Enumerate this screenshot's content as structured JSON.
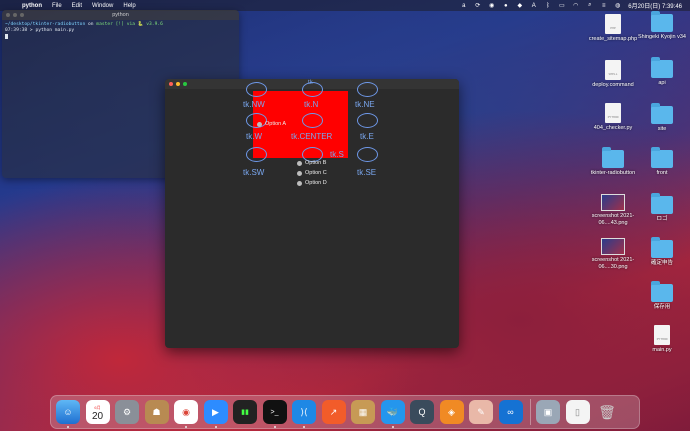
{
  "menubar": {
    "app_name": "python",
    "items": [
      "File",
      "Edit",
      "Window",
      "Help"
    ],
    "clock": "6月20日(日) 7:39:46"
  },
  "terminal": {
    "title": "python",
    "line1_path": "~/desktop/tkinter-radiobutton",
    "line1_rest": " on ",
    "line1_branch": "master [!] via 🐍 v3.9.6",
    "line2_time": "07:39:38",
    "line2_cmd": " > python main.py"
  },
  "tk": {
    "top_label": "tk",
    "anchors": [
      "tk.NW",
      "tk.N",
      "tk.NE",
      "tk.W",
      "tk.CENTER",
      "tk.E",
      "tk.SW",
      "tk.S",
      "tk.SE"
    ],
    "radio_options": [
      "Option A",
      "Option B",
      "Option C",
      "Option D"
    ]
  },
  "desktop": {
    "items": [
      {
        "label": "create_sitemap.php",
        "icon": "php-file-icon"
      },
      {
        "label": "Shingeki Kyojin v34",
        "icon": "folder-icon"
      },
      {
        "label": "deploy.command",
        "icon": "shell-file-icon"
      },
      {
        "label": "api",
        "icon": "folder-icon"
      },
      {
        "label": "404_checker.py",
        "icon": "python-file-icon"
      },
      {
        "label": "site",
        "icon": "folder-icon"
      },
      {
        "label": "tkinter-radiobutton",
        "icon": "folder-icon"
      },
      {
        "label": "front",
        "icon": "folder-icon"
      },
      {
        "label": "screenshot 2021-06....43.png",
        "icon": "image-file-icon"
      },
      {
        "label": "ロゴ",
        "icon": "folder-icon"
      },
      {
        "label": "screenshot 2021-06....30.png",
        "icon": "image-file-icon"
      },
      {
        "label": "確定申告",
        "icon": "folder-icon"
      },
      {
        "label": "保存用",
        "icon": "folder-icon"
      },
      {
        "label": "main.py",
        "icon": "python-file-icon"
      }
    ]
  },
  "dock": {
    "calendar_day": "20",
    "calendar_month": "6月"
  }
}
